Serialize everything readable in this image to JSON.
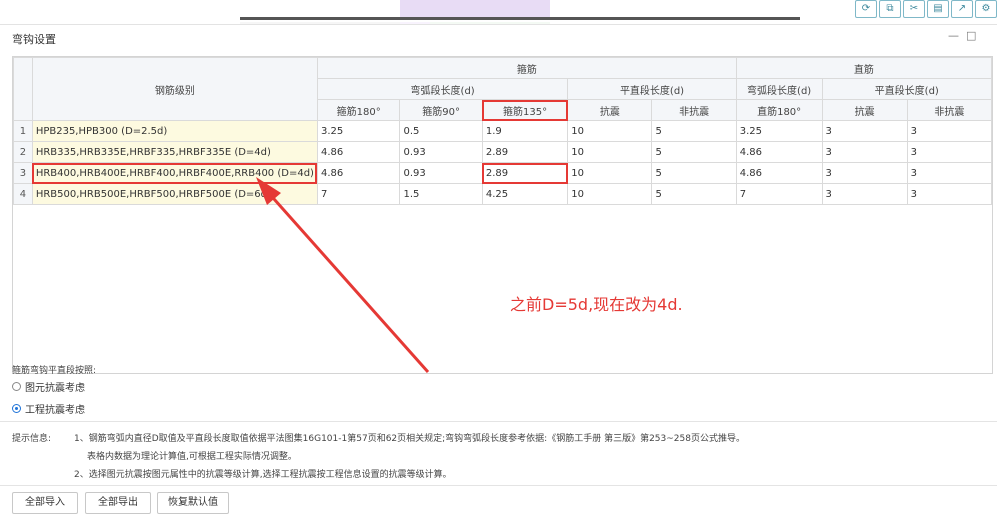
{
  "toolbar": {
    "icons": [
      "refresh-icon",
      "copy-icon",
      "cut-icon",
      "paste-icon",
      "export-icon",
      "settings-icon"
    ]
  },
  "dialog": {
    "title": "弯钩设置",
    "minimize": "—",
    "maximize": "□"
  },
  "table": {
    "headers": {
      "level": "钢筋级别",
      "stirrup": "箍筋",
      "straight": "直筋",
      "arc_len": "弯弧段长度(d)",
      "flat_len": "平直段长度(d)",
      "straight_arc": "弯弧段长度(d)",
      "straight_flat": "平直段长度(d)",
      "c180": "箍筋180°",
      "c90": "箍筋90°",
      "c135": "箍筋135°",
      "seismic": "抗震",
      "nonseismic": "非抗震",
      "s180": "直筋180°",
      "s_seismic": "抗震",
      "s_nonseismic": "非抗震"
    },
    "rows": [
      {
        "n": "1",
        "level": "HPB235,HPB300 (D=2.5d)",
        "c180": "3.25",
        "c90": "0.5",
        "c135": "1.9",
        "seismic": "10",
        "nonseismic": "5",
        "s180": "3.25",
        "s_seismic": "3",
        "s_nonseismic": "3"
      },
      {
        "n": "2",
        "level": "HRB335,HRB335E,HRBF335,HRBF335E (D=4d)",
        "c180": "4.86",
        "c90": "0.93",
        "c135": "2.89",
        "seismic": "10",
        "nonseismic": "5",
        "s180": "4.86",
        "s_seismic": "3",
        "s_nonseismic": "3"
      },
      {
        "n": "3",
        "level": "HRB400,HRB400E,HRBF400,HRBF400E,RRB400 (D=4d)",
        "c180": "4.86",
        "c90": "0.93",
        "c135": "2.89",
        "seismic": "10",
        "nonseismic": "5",
        "s180": "4.86",
        "s_seismic": "3",
        "s_nonseismic": "3"
      },
      {
        "n": "4",
        "level": "HRB500,HRB500E,HRBF500,HRBF500E (D=6d)",
        "c180": "7",
        "c90": "1.5",
        "c135": "4.25",
        "seismic": "10",
        "nonseismic": "5",
        "s180": "7",
        "s_seismic": "3",
        "s_nonseismic": "3"
      }
    ]
  },
  "annotation": {
    "note": "之前D=5d,现在改为4d.",
    "color": "#e53935"
  },
  "flat_section": {
    "label": "箍筋弯钩平直段按照:",
    "options": [
      {
        "label": "图元抗震考虑",
        "selected": false
      },
      {
        "label": "工程抗震考虑",
        "selected": true
      }
    ]
  },
  "hints": {
    "prefix": "提示信息:",
    "line1": "1、钢筋弯弧内直径D取值及平直段长度取值依据平法图集16G101-1第57页和62页相关规定;弯钩弯弧段长度参考依据:《钢筋工手册 第三版》第253~258页公式推导。",
    "line2": "表格内数据为理论计算值,可根据工程实际情况调整。",
    "line3": "2、选择图元抗震按图元属性中的抗震等级计算,选择工程抗震按工程信息设置的抗震等级计算。"
  },
  "buttons": {
    "import_all": "全部导入",
    "export_all": "全部导出",
    "restore_default": "恢复默认值"
  }
}
